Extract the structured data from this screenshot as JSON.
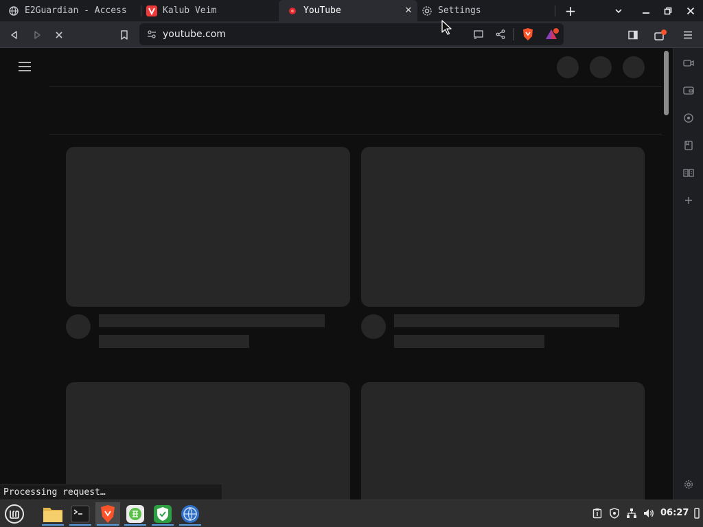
{
  "tabs": [
    {
      "title": "E2Guardian - Access",
      "icon": "globe-icon"
    },
    {
      "title": "Kalub Veim",
      "icon": "vivaldi-icon"
    },
    {
      "title": "YouTube",
      "icon": "youtube-icon",
      "active": true
    },
    {
      "title": "Settings",
      "icon": "gear-icon"
    }
  ],
  "tab_close_glyph": "✕",
  "new_tab_glyph": "+",
  "address": {
    "url": "youtube.com"
  },
  "status_text": "Processing request…",
  "clock": "06:27",
  "colors": {
    "page_bg": "#0f0f0f",
    "placeholder": "#272727",
    "toolbar": "#2b2c31",
    "tabstrip": "#1b1c20",
    "accent_brave": "#fb542b",
    "taskbar": "#2f2f2f"
  },
  "taskbar_apps": [
    "linux-mint-menu-icon",
    "files-folder-icon",
    "terminal-icon",
    "brave-browser-icon",
    "spreadsheet-icon",
    "shield-vpn-icon",
    "web-browser-icon"
  ],
  "tray_icons": [
    "clipboard-icon",
    "shield-icon",
    "network-icon",
    "volume-icon",
    "power-icon"
  ],
  "sidebar_icons": [
    "video-icon",
    "wallet-icon",
    "news-icon",
    "bookmark-icon",
    "reading-list-icon",
    "add-icon",
    "settings-icon"
  ]
}
